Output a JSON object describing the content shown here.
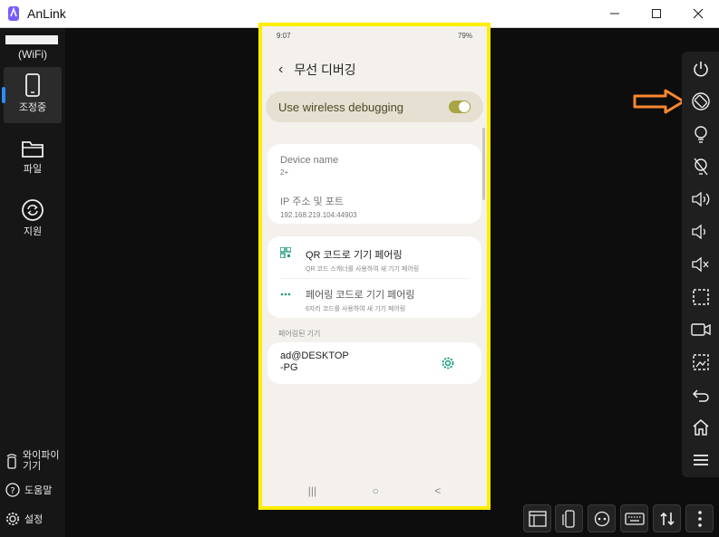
{
  "window": {
    "title": "AnLink"
  },
  "sidebar": {
    "connection": "(WiFi)",
    "items": [
      {
        "label": "조정중",
        "icon": "phone-icon",
        "active": true
      },
      {
        "label": "파일",
        "icon": "folder-icon"
      },
      {
        "label": "지원",
        "icon": "sync-icon"
      }
    ],
    "bottom": [
      {
        "label": "와이파이 기기",
        "line1": "와이파이",
        "line2": "기기",
        "icon": "wifi-device-icon"
      },
      {
        "label": "도움말",
        "icon": "help-icon"
      },
      {
        "label": "설정",
        "icon": "settings-icon"
      }
    ]
  },
  "phone": {
    "status": {
      "time": "9:07",
      "battery": "79%"
    },
    "header": {
      "title": "무선 디버깅"
    },
    "toggle": {
      "label": "Use wireless debugging",
      "on": true
    },
    "device_card": {
      "device_name_label": "Device name",
      "device_name_value": "2+",
      "ip_label": "IP 주소 및 포트",
      "ip_value": "192.168.219.104:44903"
    },
    "pairing": [
      {
        "title": "QR 코드로 기기 페어링",
        "subtitle": "QR 코드 스캐너를 사용하여 새 기기 페어링",
        "icon": "qr-icon"
      },
      {
        "title": "페어링 코드로 기기 페어링",
        "subtitle": "6자리 코드를 사용하여 새 기기 페어링",
        "icon": "dots-icon"
      }
    ],
    "paired_section_label": "페어링된 기기",
    "paired_device": {
      "line1": "ad@DESKTOP",
      "line2": "-PG"
    },
    "nav": {
      "recents": "|||",
      "home": "○",
      "back": "<"
    }
  },
  "right_toolbar": [
    "power-icon",
    "rotate-icon",
    "light-on-icon",
    "light-off-icon",
    "volume-up-icon",
    "volume-down-icon",
    "mute-icon",
    "screenshot-region-icon",
    "record-icon",
    "screenshot-icon",
    "back-icon",
    "home-icon",
    "menu-icon"
  ],
  "bottom_toolbar": [
    "window-layout-icon",
    "phone-window-icon",
    "gamepad-icon",
    "keyboard-icon",
    "transfer-icon",
    "more-icon"
  ],
  "colors": {
    "highlight_frame": "#ffee00",
    "arrow": "#f7882f",
    "accent": "#2a8cff",
    "toggle": "#a8a542",
    "link_icon": "#1a9a7d"
  }
}
